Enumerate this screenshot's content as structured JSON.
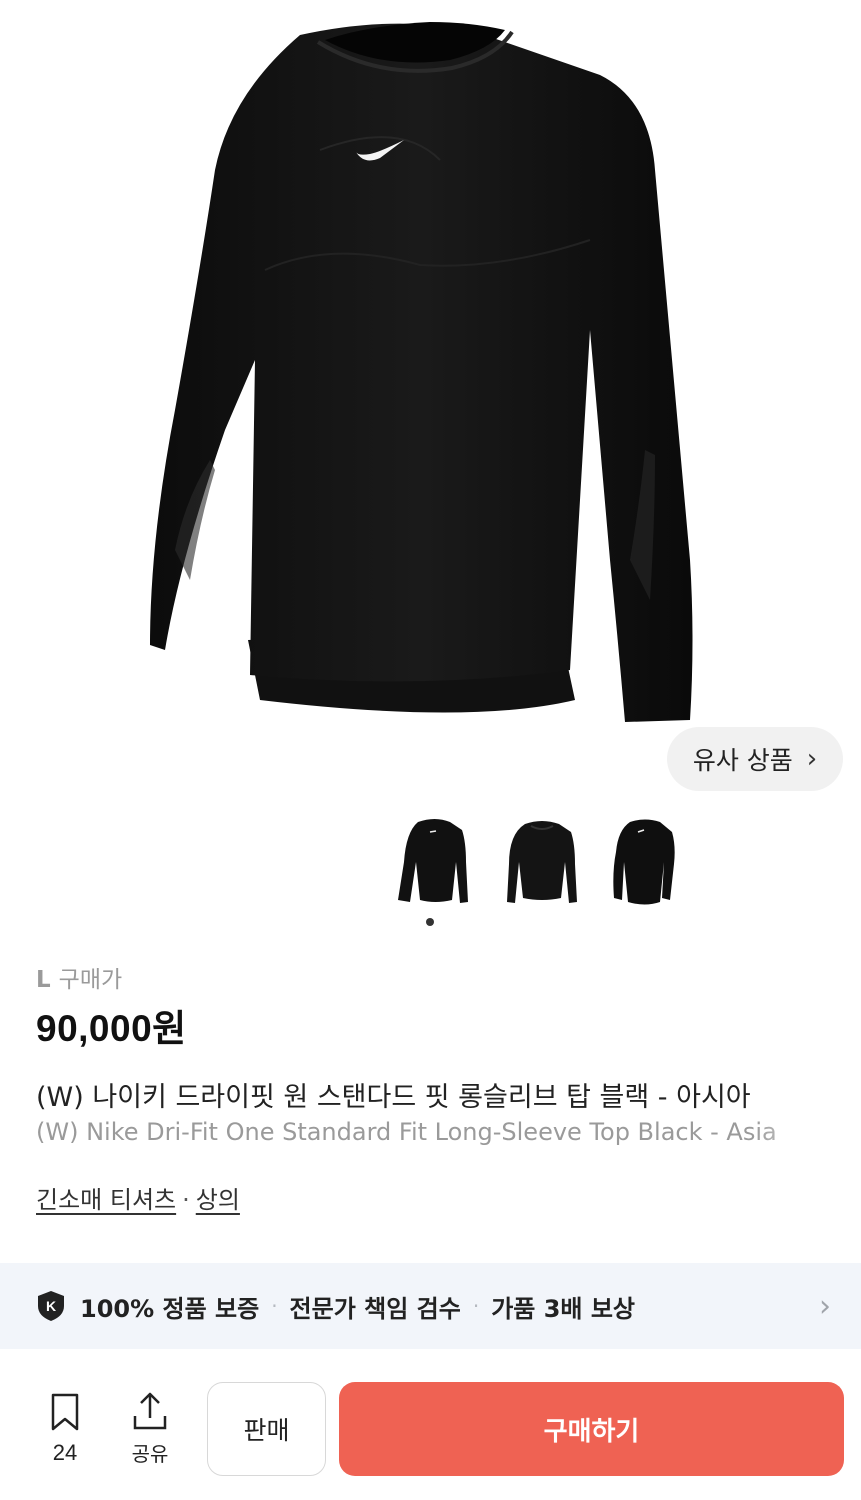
{
  "hero": {
    "image_icon": "black-long-sleeve-top-image",
    "similar_button_label": "유사 상품",
    "similar_button_icon": "chevron-right-icon"
  },
  "thumbnails": [
    "thumbnail-1",
    "thumbnail-2",
    "thumbnail-3"
  ],
  "pager": {
    "active_index": 1,
    "total": 1
  },
  "product": {
    "size": "L",
    "price_label": "구매가",
    "price": "90,000원",
    "title_ko": "(W) 나이키 드라이핏 원 스탠다드 핏 롱슬리브 탑 블랙 - 아시아",
    "title_en": "(W) Nike Dri-Fit One Standard Fit Long-Sleeve Top Black - Asia",
    "category_1": "긴소매 티셔츠",
    "category_sep": "·",
    "category_2": "상의"
  },
  "guarantee": {
    "item_1": "100% 정품 보증",
    "item_2": "전문가 책임 검수",
    "item_3": "가품 3배 보상",
    "separator": "·"
  },
  "bottom_bar": {
    "bookmark_count": "24",
    "share_label": "공유",
    "sell_label": "판매",
    "buy_label": "구매하기"
  },
  "colors": {
    "buy_button": "#ef6253",
    "banner_bg": "#f2f5fa"
  }
}
